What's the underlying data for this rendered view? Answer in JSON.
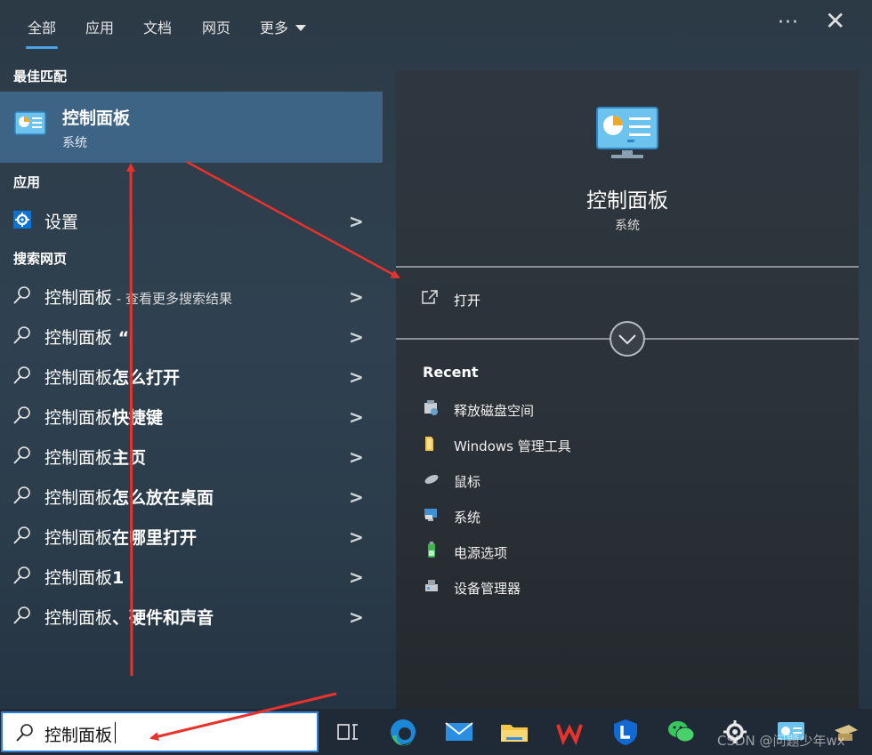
{
  "tabs": [
    {
      "label": "全部",
      "active": true
    },
    {
      "label": "应用"
    },
    {
      "label": "文档"
    },
    {
      "label": "网页"
    },
    {
      "label": "更多"
    }
  ],
  "top_actions": {
    "more_options_icon": "ellipsis-icon",
    "close_icon": "close-icon"
  },
  "best_match": {
    "section_label": "最佳匹配",
    "title": "控制面板",
    "subtitle": "系统",
    "icon": "control-panel-icon"
  },
  "apps": {
    "section_label": "应用",
    "items": [
      {
        "label": "设置",
        "icon": "gear-icon"
      }
    ]
  },
  "web": {
    "section_label": "搜索网页",
    "items": [
      {
        "query": "控制面板",
        "suffix": "",
        "hint": " - 查看更多搜索结果"
      },
      {
        "query": "控制面板",
        "suffix": " “",
        "hint": ""
      },
      {
        "query": "控制面板",
        "suffix": "怎么打开",
        "hint": ""
      },
      {
        "query": "控制面板",
        "suffix": "快捷键",
        "hint": ""
      },
      {
        "query": "控制面板",
        "suffix": "主页",
        "hint": ""
      },
      {
        "query": "控制面板",
        "suffix": "怎么放在桌面",
        "hint": ""
      },
      {
        "query": "控制面板",
        "suffix": "在哪里打开",
        "hint": ""
      },
      {
        "query": "控制面板",
        "suffix": "1",
        "hint": ""
      },
      {
        "query": "控制面板",
        "suffix": "、硬件和声音",
        "hint": ""
      }
    ]
  },
  "detail": {
    "title": "控制面板",
    "subtitle": "系统",
    "open_label": "打开",
    "recent_heading": "Recent",
    "recent": [
      {
        "label": "释放磁盘空间",
        "icon": "disk-cleanup-icon"
      },
      {
        "label": "Windows 管理工具",
        "icon": "folder-icon"
      },
      {
        "label": "鼠标",
        "icon": "mouse-icon"
      },
      {
        "label": "系统",
        "icon": "computer-icon"
      },
      {
        "label": "电源选项",
        "icon": "power-options-icon"
      },
      {
        "label": "设备管理器",
        "icon": "device-manager-icon"
      }
    ]
  },
  "taskbar": {
    "search_value": "控制面板",
    "apps": [
      "task-view-icon",
      "edge-icon",
      "mail-icon",
      "file-explorer-icon",
      "wps-icon",
      "lenovo-icon",
      "wechat-icon",
      "settings-icon",
      "control-panel-icon",
      "app-icon"
    ]
  },
  "watermark": "CSDN @问题少年wx",
  "colors": {
    "accent": "#4aa3e6",
    "best_match_bg": "#3e6485",
    "annotation_arrow": "#e8322c"
  }
}
